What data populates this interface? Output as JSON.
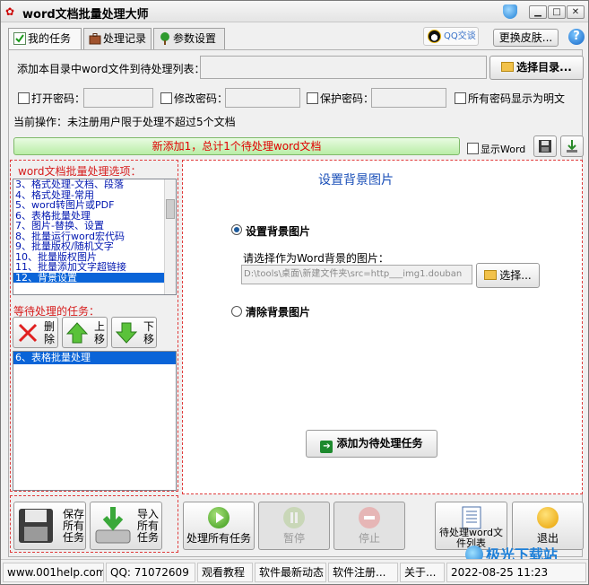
{
  "window": {
    "title": "word文档批量处理大师",
    "minimize": "▁",
    "maximize": "□",
    "close": "✕"
  },
  "tabs": [
    {
      "label": "我的任务",
      "icon": "check-icon"
    },
    {
      "label": "处理记录",
      "icon": "briefcase-icon"
    },
    {
      "label": "参数设置",
      "icon": "tree-icon"
    }
  ],
  "qq_badge": "QQ交谈",
  "skin_button": "更换皮肤...",
  "add_dir_label": "添加本目录中word文件到待处理列表：",
  "add_dir_value": "",
  "select_dir_button": "选择目录...",
  "options": {
    "open_pwd": "打开密码：",
    "edit_pwd": "修改密码：",
    "protect_pwd": "保护密码：",
    "show_plain": "所有密码显示为明文"
  },
  "current_op": "当前操作：未注册用户限于处理不超过5个文档",
  "progress": {
    "text": "新添加1，总计1个待处理word文档"
  },
  "show_word": "显示Word",
  "options_list": {
    "header": "word文档批量处理选项：",
    "items": [
      "3、格式处理-文档、段落",
      "4、格式处理-常用",
      "5、word转图片或PDF",
      "6、表格批量处理",
      "7、图片-替换、设置",
      "8、批量运行word宏代码",
      "9、批量版权/随机文字",
      "10、批量版权图片",
      "11、批量添加文字超链接",
      "12、背景设置"
    ],
    "selected_index": 9
  },
  "pending": {
    "header": "等待处理的任务：",
    "delete_button": "删除",
    "up_button": "上移",
    "down_button": "下移",
    "items": [
      "6、表格批量处理"
    ]
  },
  "main": {
    "title": "设置背景图片",
    "radio_set": "设置背景图片",
    "choose_prompt": "请选择作为Word背景的图片：",
    "image_path": "D:\\tools\\桌面\\新建文件夹\\src=http___img1.douban",
    "choose_button": "选择...",
    "radio_clear": "清除背景图片",
    "add_task_button": "添加为待处理任务"
  },
  "bottom": {
    "save_tasks": "保存所有任务",
    "import_tasks": "导入所有任务",
    "process_all": "处理所有任务",
    "pause": "暂停",
    "stop": "停止",
    "pending_list": "待处理word文件列表",
    "exit": "退出"
  },
  "status": {
    "website": "www.001help.com",
    "qq": "QQ:  71072609",
    "tutorial": "观看教程",
    "news": "软件最新动态",
    "register": "软件注册...",
    "about": "关于...",
    "datetime": "2022-08-25 11:23"
  },
  "watermark": "极光下载站",
  "colors": {
    "selection": "#0a64d8",
    "list_text": "#0016b0",
    "red_label": "#d61c1c",
    "progress_green": "#b9eda6"
  }
}
